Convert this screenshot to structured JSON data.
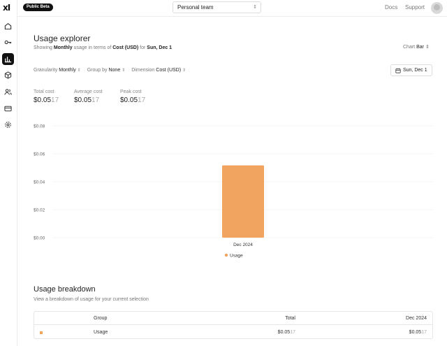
{
  "app": {
    "logo": "xI"
  },
  "topbar": {
    "badge": "Public Beta",
    "team": "Personal team",
    "links": [
      "Docs",
      "Support"
    ]
  },
  "page": {
    "title": "Usage explorer",
    "subtitle": {
      "pre": "Showing",
      "period": "Monthly",
      "mid": "usage in terms of",
      "metric": "Cost (USD)",
      "for": "for",
      "date": "Sun, Dec 1"
    },
    "chart_select": {
      "label": "Chart",
      "value": "Bar"
    }
  },
  "filters": {
    "granularity": {
      "label": "Granularity",
      "value": "Monthly"
    },
    "group_by": {
      "label": "Group by",
      "value": "None"
    },
    "dimension": {
      "label": "Dimension",
      "value": "Cost (USD)"
    }
  },
  "date_button": "Sun, Dec 1",
  "stats": [
    {
      "label": "Total cost",
      "value_main": "$0.05",
      "value_dim": "17"
    },
    {
      "label": "Average cost",
      "value_main": "$0.05",
      "value_dim": "17"
    },
    {
      "label": "Peak cost",
      "value_main": "$0.05",
      "value_dim": "17"
    }
  ],
  "chart_data": {
    "type": "bar",
    "categories": [
      "Dec 2024"
    ],
    "series": [
      {
        "name": "Usage",
        "values": [
          0.0517
        ],
        "color": "#f0a460"
      }
    ],
    "y_ticks": [
      "$0.08",
      "$0.06",
      "$0.04",
      "$0.02",
      "$0.00"
    ],
    "ylim": [
      0,
      0.08
    ],
    "legend": "bottom-center",
    "grid": true
  },
  "breakdown": {
    "title": "Usage breakdown",
    "subtitle": "View a breakdown of usage for your current selection",
    "headers": [
      "Group",
      "Total",
      "Dec 2024"
    ],
    "rows": [
      {
        "group": "Usage",
        "total_main": "$0.05",
        "total_dim": "17",
        "dec_main": "$0.05",
        "dec_dim": "17"
      }
    ]
  }
}
